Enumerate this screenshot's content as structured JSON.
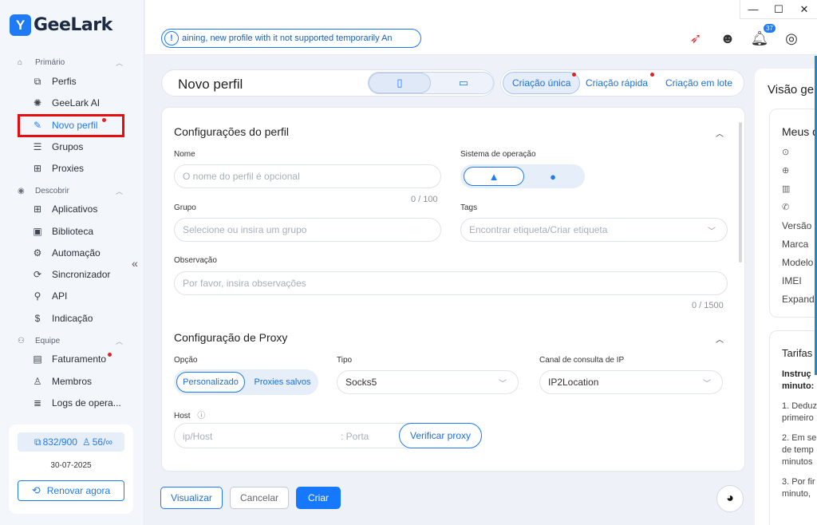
{
  "app": {
    "logo_text": "GeeLark",
    "brand_color": "#1e7af5"
  },
  "sidebar": {
    "sections": [
      {
        "label": "Primário",
        "icon": "home-icon"
      },
      {
        "label": "Descobrir",
        "icon": "eye-icon"
      },
      {
        "label": "Equipe",
        "icon": "team-icon"
      }
    ],
    "items": [
      {
        "label": "Perfis",
        "icon": "profiles-icon"
      },
      {
        "label": "GeeLark AI",
        "icon": "ai-icon"
      },
      {
        "label": "Novo perfil",
        "icon": "edit-icon",
        "active": true
      },
      {
        "label": "Grupos",
        "icon": "list-icon"
      },
      {
        "label": "Proxies",
        "icon": "proxy-icon"
      },
      {
        "label": "Aplicativos",
        "icon": "apps-icon"
      },
      {
        "label": "Biblioteca",
        "icon": "library-icon"
      },
      {
        "label": "Automação",
        "icon": "robot-icon"
      },
      {
        "label": "Sincronizador",
        "icon": "sync-icon"
      },
      {
        "label": "API",
        "icon": "api-icon"
      },
      {
        "label": "Indicação",
        "icon": "dollar-icon"
      },
      {
        "label": "Faturamento",
        "icon": "billing-icon"
      },
      {
        "label": "Membros",
        "icon": "user-icon"
      },
      {
        "label": "Logs de opera...",
        "icon": "logs-icon"
      }
    ],
    "plan": {
      "profiles": "832/900",
      "members": "56/∞",
      "date": "30-07-2025",
      "renew_label": "Renovar agora"
    }
  },
  "topbar": {
    "notice": "aining, new profile with it not supported temporarily  An",
    "notification_count": "37"
  },
  "header": {
    "title": "Novo perfil",
    "modes": [
      "Criação única",
      "Criação rápida",
      "Criação em lote"
    ]
  },
  "profile_config": {
    "title": "Configurações do perfil",
    "name_label": "Nome",
    "name_placeholder": "O nome do perfil é opcional",
    "name_counter": "0 / 100",
    "os_label": "Sistema de operação",
    "group_label": "Grupo",
    "group_placeholder": "Selecione ou insira um grupo",
    "tags_label": "Tags",
    "tags_placeholder": "Encontrar etiqueta/Criar etiqueta",
    "notes_label": "Observação",
    "notes_placeholder": "Por favor, insira observações",
    "notes_counter": "0 / 1500"
  },
  "proxy_config": {
    "title": "Configuração de Proxy",
    "option_label": "Opção",
    "option_selected": "Personalizado",
    "option_other": "Proxies salvos",
    "type_label": "Tipo",
    "type_value": "Socks5",
    "ip_label": "Canal de consulta de IP",
    "ip_value": "IP2Location",
    "host_label": "Host",
    "host_placeholder": "ip/Host",
    "port_placeholder": ": Porta",
    "verify_label": "Verificar proxy"
  },
  "actions": {
    "preview": "Visualizar",
    "cancel": "Cancelar",
    "create": "Criar"
  },
  "right_panel": {
    "title": "Visão ge",
    "device_title": "Meus d",
    "version": "Versão",
    "brand": "Marca",
    "model": "Modelo",
    "imei": "IMEI",
    "expand": "Expanda",
    "rates_title": "Tarifas",
    "instr_1": "Instruç",
    "instr_2": "minuto:",
    "r1a": "1. Deduz",
    "r1b": "primeiro",
    "r2a": "2. Em se",
    "r2b": "de temp",
    "r2c": "minutos",
    "r3a": "3. Por fir",
    "r3b": "minuto,"
  }
}
